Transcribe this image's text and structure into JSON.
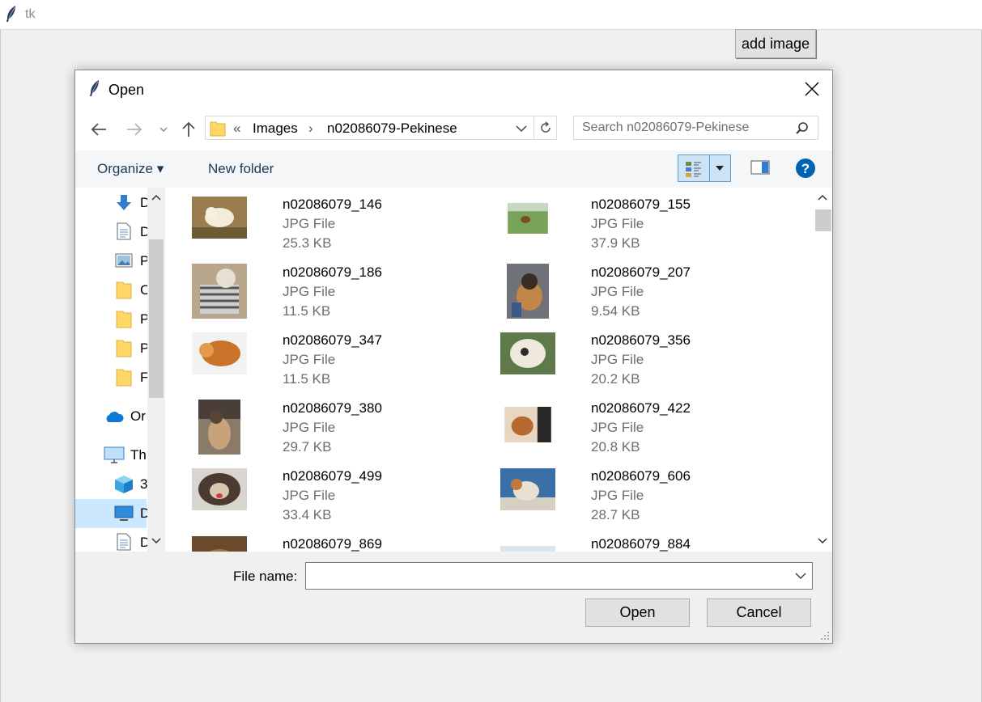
{
  "app_window": {
    "title": "tk",
    "add_image_label": "add image"
  },
  "dialog": {
    "title": "Open",
    "address": {
      "overflow": "«",
      "segments": [
        "Images",
        "n02086079-Pekinese"
      ],
      "separator": "›"
    },
    "search_placeholder": "Search n02086079-Pekinese",
    "toolbar": {
      "organize_label": "Organize ▾",
      "new_folder_label": "New folder"
    },
    "nav_items": [
      {
        "label": "D",
        "icon": "downloads-icon"
      },
      {
        "label": "D",
        "icon": "documents-icon"
      },
      {
        "label": "P",
        "icon": "pictures-icon"
      },
      {
        "label": "C",
        "icon": "folder-icon"
      },
      {
        "label": "P",
        "icon": "folder-icon"
      },
      {
        "label": "P",
        "icon": "folder-icon"
      },
      {
        "label": "F",
        "icon": "folder-icon"
      },
      {
        "label": "Or",
        "icon": "onedrive-icon"
      },
      {
        "label": "Th",
        "icon": "this-pc-icon"
      },
      {
        "label": "3",
        "icon": "3d-objects-icon"
      },
      {
        "label": "D",
        "icon": "desktop-icon"
      },
      {
        "label": "D",
        "icon": "documents-icon"
      }
    ],
    "files": [
      {
        "name": "n02086079_146",
        "type": "JPG File",
        "size": "25.3 KB"
      },
      {
        "name": "n02086079_155",
        "type": "JPG File",
        "size": "37.9 KB"
      },
      {
        "name": "n02086079_186",
        "type": "JPG File",
        "size": "11.5 KB"
      },
      {
        "name": "n02086079_207",
        "type": "JPG File",
        "size": "9.54 KB"
      },
      {
        "name": "n02086079_347",
        "type": "JPG File",
        "size": "11.5 KB"
      },
      {
        "name": "n02086079_356",
        "type": "JPG File",
        "size": "20.2 KB"
      },
      {
        "name": "n02086079_380",
        "type": "JPG File",
        "size": "29.7 KB"
      },
      {
        "name": "n02086079_422",
        "type": "JPG File",
        "size": "20.8 KB"
      },
      {
        "name": "n02086079_499",
        "type": "JPG File",
        "size": "33.4 KB"
      },
      {
        "name": "n02086079_606",
        "type": "JPG File",
        "size": "28.7 KB"
      },
      {
        "name": "n02086079_869",
        "type": "",
        "size": ""
      },
      {
        "name": "n02086079_884",
        "type": "",
        "size": ""
      }
    ],
    "file_name_label": "File name:",
    "file_name_value": "",
    "open_label": "Open",
    "cancel_label": "Cancel"
  },
  "colors": {
    "accent": "#0063b1",
    "selection": "#cce8ff",
    "link_text": "#1e395b",
    "secondary_text": "#6d6d6d"
  }
}
